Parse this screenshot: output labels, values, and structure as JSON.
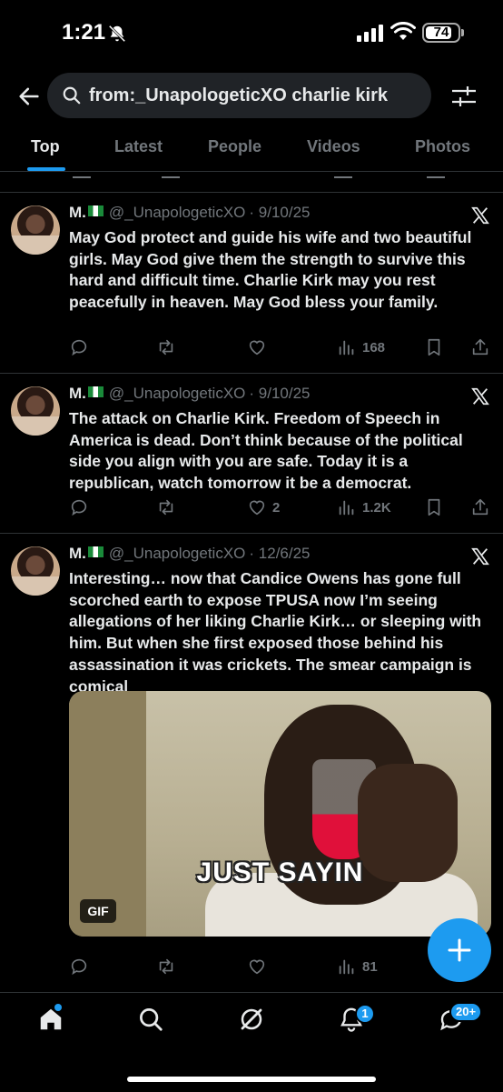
{
  "status": {
    "time": "1:21",
    "battery": "74"
  },
  "search": {
    "query": "from:_UnapologeticXO charlie kirk"
  },
  "tabs": [
    {
      "label": "Top",
      "active": true
    },
    {
      "label": "Latest"
    },
    {
      "label": "People"
    },
    {
      "label": "Videos"
    },
    {
      "label": "Photos"
    }
  ],
  "tweets": [
    {
      "name": "M.",
      "handle": "@_UnapologeticXO",
      "date": "· 9/10/25",
      "text": "May God protect and guide his wife and two beautiful girls. May God give them the strength to survive this hard and difficult time. Charlie Kirk may you rest peacefully in heaven. May God bless your family.",
      "likes": "",
      "views": "168"
    },
    {
      "name": "M.",
      "handle": "@_UnapologeticXO",
      "date": "· 9/10/25",
      "text": "The attack on Charlie Kirk. Freedom of Speech in America is dead. Don’t think because of the political side you align with you are safe. Today it is a republican, watch tomorrow it be a democrat.",
      "likes": "2",
      "views": "1.2K"
    },
    {
      "name": "M.",
      "handle": "@_UnapologeticXO",
      "date": "· 12/6/25",
      "text": "Interesting… now that Candice Owens has gone full scorched earth to expose TPUSA now I’m seeing allegations of her liking Charlie Kirk… or sleeping with him. But when she first exposed those behind his assassination it was crickets. The smear campaign is comical",
      "gif_caption": "JUST SAYIN",
      "gif_badge": "GIF",
      "views": "81"
    }
  ],
  "nav": {
    "notifications": "1",
    "messages": "20+"
  },
  "colors": {
    "accent": "#1d9bf0",
    "muted": "#71767b",
    "text": "#e7e9ea"
  }
}
